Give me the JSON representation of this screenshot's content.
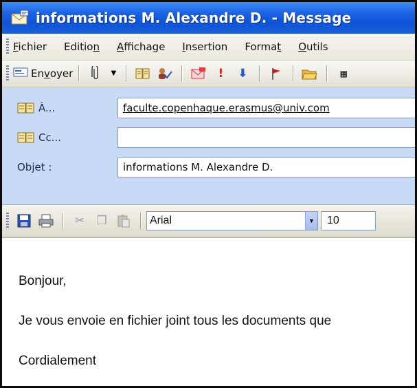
{
  "window": {
    "title": "informations M. Alexandre D. - Message"
  },
  "menubar": {
    "items": [
      {
        "label_pre": "",
        "label_ul": "F",
        "label_post": "ichier"
      },
      {
        "label_pre": "Editio",
        "label_ul": "n",
        "label_post": ""
      },
      {
        "label_pre": "",
        "label_ul": "A",
        "label_post": "ffichage"
      },
      {
        "label_pre": "",
        "label_ul": "I",
        "label_post": "nsertion"
      },
      {
        "label_pre": "Forma",
        "label_ul": "t",
        "label_post": ""
      },
      {
        "label_pre": "",
        "label_ul": "O",
        "label_post": "utils"
      }
    ]
  },
  "toolbar": {
    "send_pre": "En",
    "send_ul": "v",
    "send_post": "oyer"
  },
  "header": {
    "to_label": "À...",
    "to_value": "faculte.copenhaque.erasmus@univ.com",
    "cc_label": "Cc...",
    "cc_value": "",
    "subject_label": "Objet :",
    "subject_value": "informations M. Alexandre D."
  },
  "format": {
    "font": "Arial",
    "size": "10"
  },
  "body": {
    "greeting": "Bonjour,",
    "line1": "Je vous envoie en fichier joint tous les documents que",
    "closing": "Cordialement"
  },
  "colors": {
    "titlebar": "#1b62e4",
    "header_bg": "#c9daf6",
    "link": "#1a1a1a"
  },
  "icons": [
    "envelope-icon",
    "paperclip-icon",
    "address-book-icon",
    "check-names-icon",
    "options-icon",
    "high-importance-icon",
    "low-importance-icon",
    "flag-icon",
    "folder-icon",
    "save-icon",
    "print-icon",
    "cut-icon",
    "copy-icon",
    "paste-icon"
  ]
}
